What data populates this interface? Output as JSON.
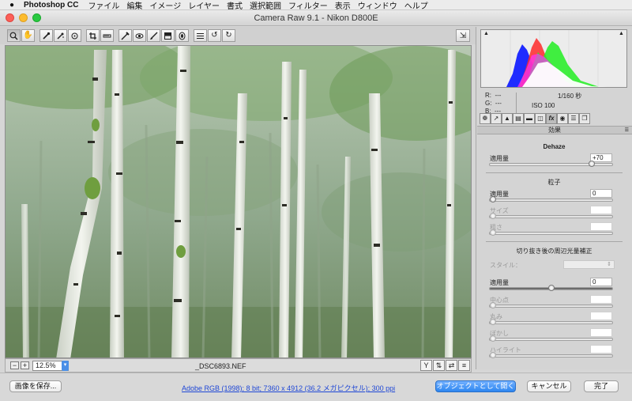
{
  "menubar": {
    "apple": "",
    "app": "Photoshop CC",
    "items": [
      "ファイル",
      "編集",
      "イメージ",
      "レイヤー",
      "書式",
      "選択範囲",
      "フィルター",
      "表示",
      "ウィンドウ",
      "ヘルプ"
    ]
  },
  "window": {
    "title": "Camera Raw 9.1  -  Nikon D800E"
  },
  "toolbar": {
    "tools": [
      "zoom-tool-icon",
      "hand-tool-icon",
      "white-balance-tool-icon",
      "color-sampler-tool-icon",
      "targeted-adjustment-tool-icon",
      "crop-tool-icon",
      "straighten-tool-icon",
      "spot-removal-tool-icon",
      "red-eye-removal-tool-icon",
      "adjustment-brush-icon",
      "graduated-filter-icon",
      "radial-filter-icon",
      "preferences-icon",
      "rotate-ccw-icon",
      "rotate-cw-icon"
    ]
  },
  "status": {
    "zoom_out": "−",
    "zoom_in": "+",
    "zoom": "12.5%",
    "filename": "_DSC6893.NEF"
  },
  "readout": {
    "r_label": "R:",
    "r_val": "---",
    "g_label": "G:",
    "g_val": "---",
    "b_label": "B:",
    "b_val": "---",
    "shutter": "1/160 秒",
    "iso": "ISO 100"
  },
  "panel": {
    "section_title": "効果",
    "dehaze": {
      "title": "Dehaze",
      "amount_label": "適用量",
      "amount": "+70",
      "level": 0.85
    },
    "grain": {
      "title": "粒子",
      "amount_label": "適用量",
      "amount": "0",
      "amount_level": 0,
      "size_label": "サイズ",
      "size": "",
      "size_level": 0,
      "roughness_label": "粗さ",
      "roughness": "",
      "roughness_level": 0
    },
    "vignette": {
      "title": "切り抜き後の周辺光量補正",
      "style_label": "スタイル：",
      "amount_label": "適用量",
      "amount": "0",
      "amount_level": 0.5,
      "midpoint_label": "中心点",
      "midpoint_level": 0,
      "roundness_label": "丸み",
      "roundness_level": 0,
      "feather_label": "ぼかし",
      "feather_level": 0,
      "highlights_label": "ハイライト",
      "highlights_level": 0
    }
  },
  "bottom": {
    "save_label": "画像を保存...",
    "workflow": "Adobe RGB (1998); 8 bit; 7360 x 4912 (36.2 メガピクセル); 300 ppi",
    "open_label": "オブジェクトとして開く",
    "cancel_label": "キャンセル",
    "done_label": "完了"
  },
  "colors": {
    "accent": "#2d86f0",
    "link": "#1f47d6"
  }
}
